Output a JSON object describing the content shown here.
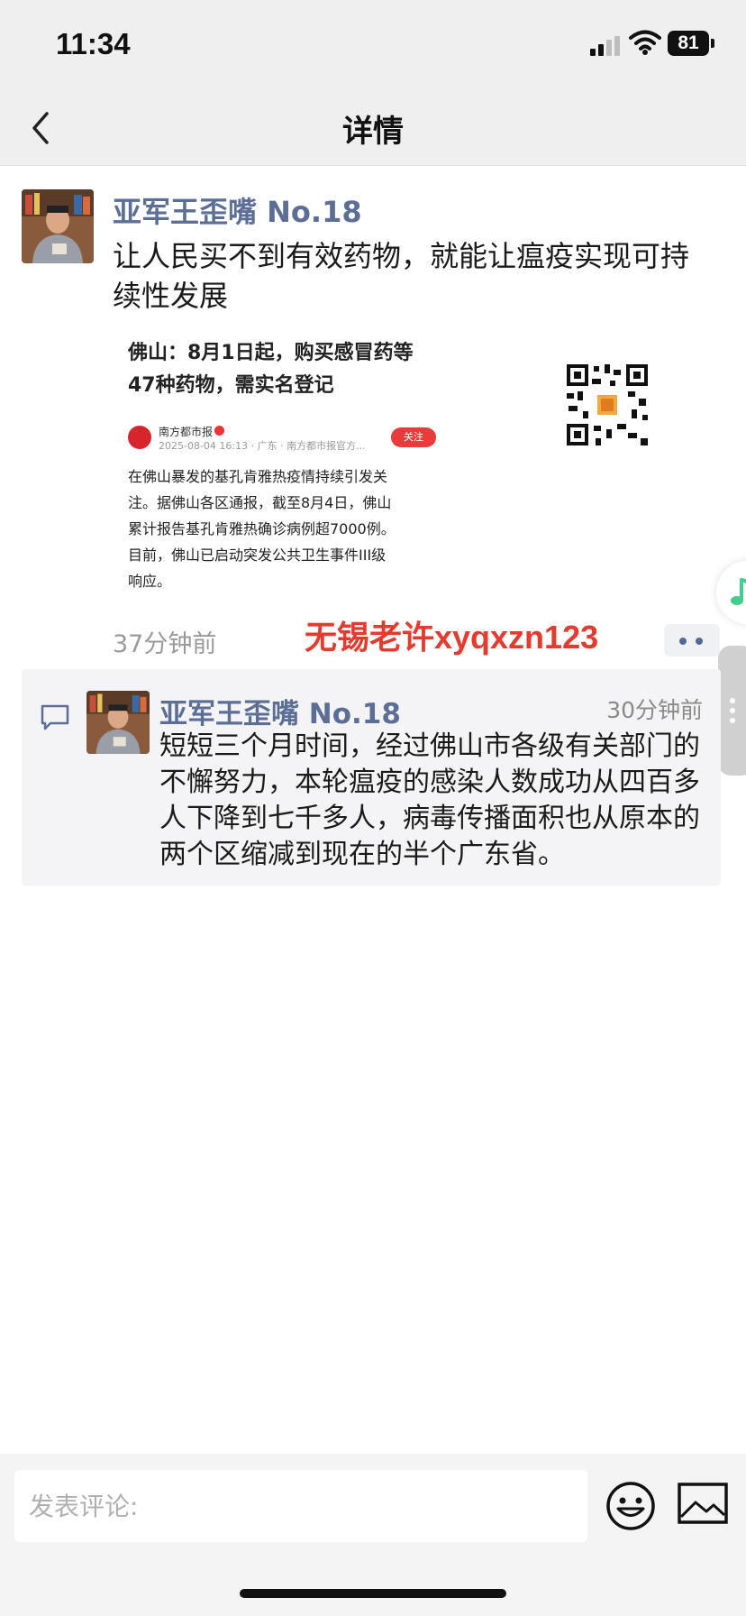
{
  "status_bar": {
    "time": "11:34",
    "battery": "81"
  },
  "nav": {
    "title": "详情",
    "back_icon": "chevron-left-icon"
  },
  "post": {
    "username": "亚军王歪嘴 No.18",
    "text": "让人民买不到有效药物，就能让瘟疫实现可持续性发展",
    "time": "37分钟前",
    "watermark": "无锡老许xyqxzn123",
    "embedded_image": {
      "title": "佛山：8月1日起，购买感冒药等47种药物，需实名登记",
      "source_name": "南方都市报",
      "source_meta": "2025-08-04 16:13 · 广东 · 南方都市报官方...",
      "follow_label": "关注",
      "body": "在佛山暴发的基孔肯雅热疫情持续引发关注。据佛山各区通报，截至8月4日，佛山累计报告基孔肯雅热确诊病例超7000例。目前，佛山已启动突发公共卫生事件III级响应。"
    }
  },
  "comment": {
    "username": "亚军王歪嘴 No.18",
    "time": "30分钟前",
    "text": "短短三个月时间，经过佛山市各级有关部门的不懈努力，本轮瘟疫的感染人数成功从四百多人下降到七千多人，病毒传播面积也从原本的两个区缩减到现在的半个广东省。"
  },
  "bottom_bar": {
    "input_placeholder": "发表评论:"
  },
  "colors": {
    "username": "#5c6e95",
    "watermark": "#e53a2e",
    "follow": "#e93b3b",
    "music": "#3fd08c"
  }
}
